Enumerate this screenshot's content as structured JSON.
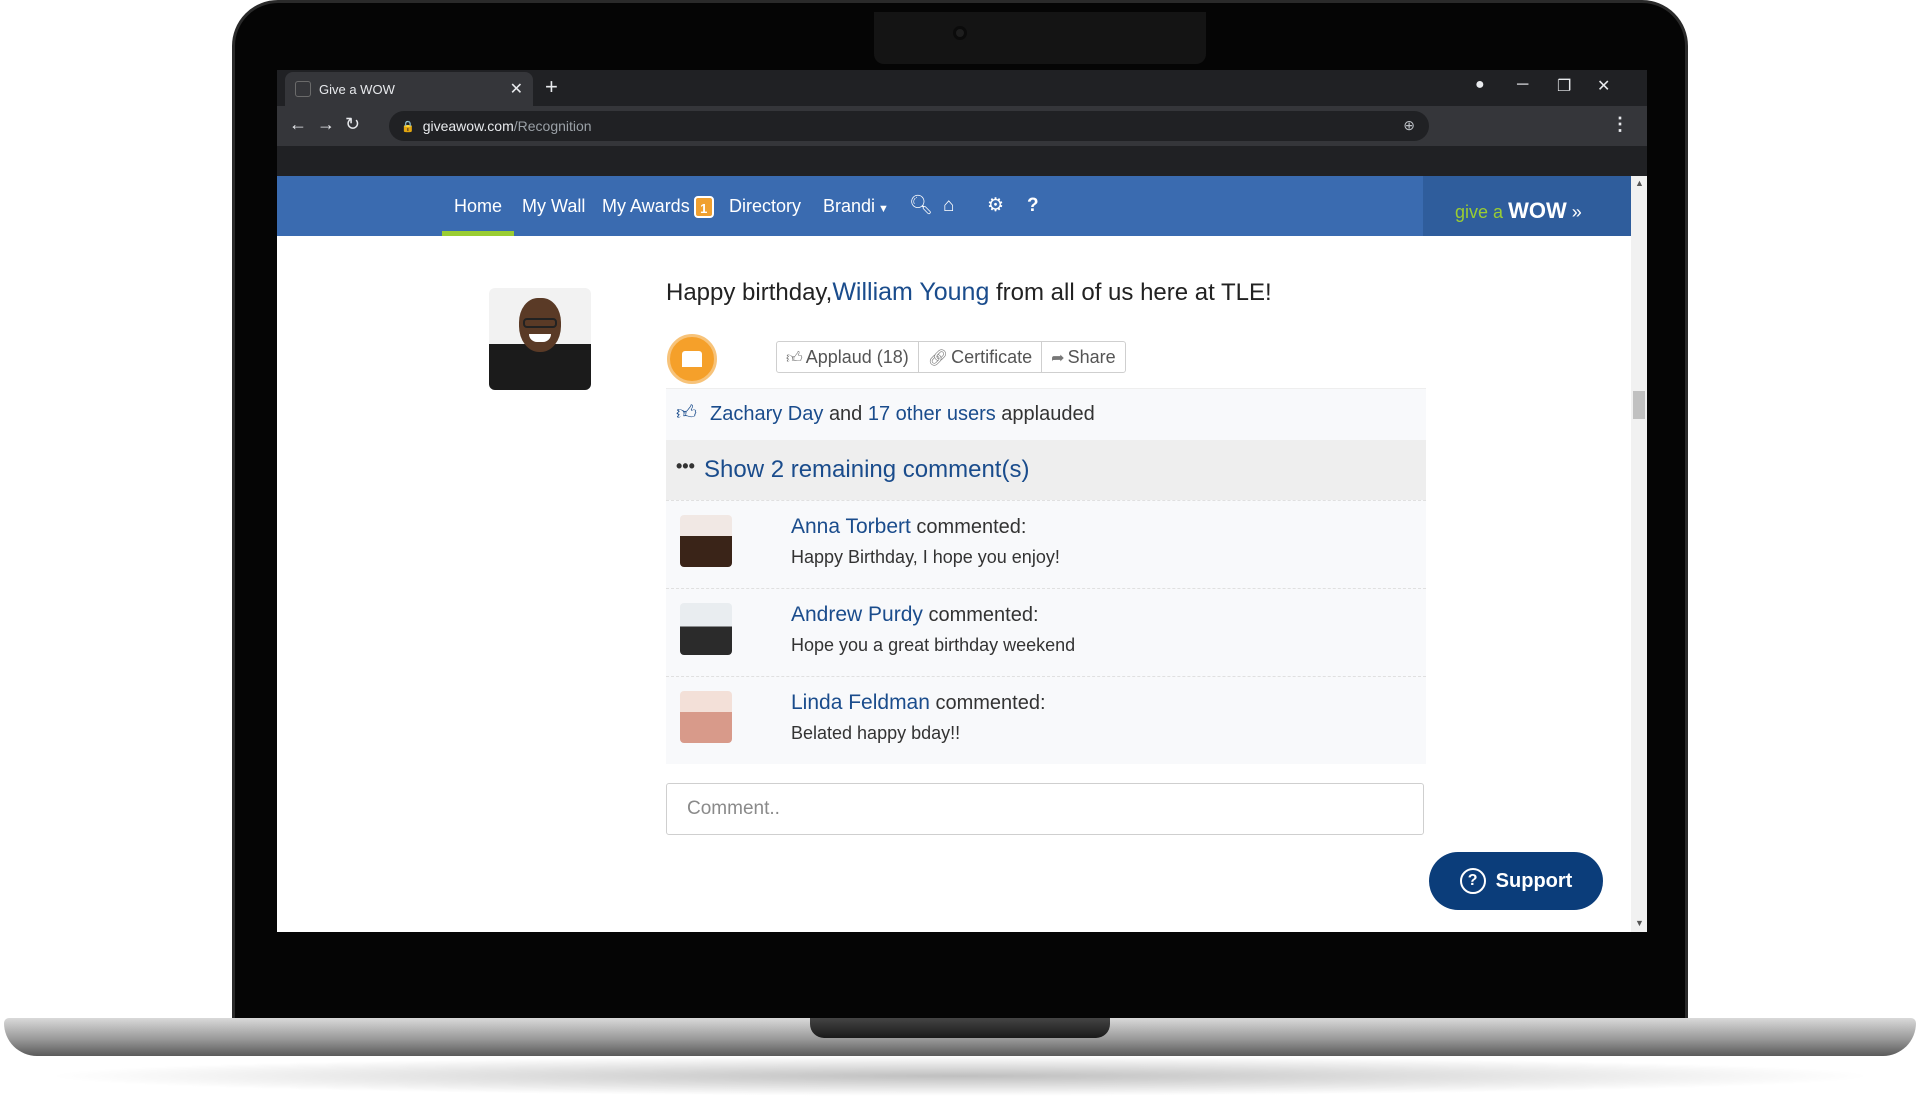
{
  "browser": {
    "tab_title": "Give a WOW",
    "new_tab_label": "+",
    "url_host": "giveawow.com",
    "url_path": "/Recognition"
  },
  "nav": {
    "items": [
      {
        "label": "Home",
        "active": true
      },
      {
        "label": "My Wall"
      },
      {
        "label": "My Awards",
        "badge": "1"
      },
      {
        "label": "Directory"
      },
      {
        "label": "Brandi"
      }
    ],
    "help_label": "?",
    "brand_give": "give a",
    "brand_wow": "WOW",
    "brand_arrows": "»"
  },
  "post": {
    "headline_prefix": "Happy birthday,",
    "recipient": "William Young",
    "headline_suffix": "from all of us here at TLE!",
    "actions": {
      "applaud": "Applaud (18)",
      "certificate": "Certificate",
      "share": "Share"
    },
    "applauded": {
      "first_user": "Zachary Day",
      "and": "and",
      "others": "17 other users",
      "suffix": "applauded"
    },
    "show_remaining": "Show 2 remaining comment(s)",
    "commented_word": "commented:",
    "comments": [
      {
        "author": "Anna Torbert",
        "text": "Happy Birthday, I hope you enjoy!"
      },
      {
        "author": "Andrew Purdy",
        "text": "Hope you a great birthday weekend"
      },
      {
        "author": "Linda Feldman",
        "text": "Belated happy bday!!"
      }
    ],
    "comment_placeholder": "Comment.."
  },
  "support": {
    "label": "Support"
  },
  "colors": {
    "nav_bg": "#3a6bb0",
    "link": "#1a4c8c",
    "accent_green": "#9acd32",
    "support_bg": "#0b3d7a",
    "badge": "#f0a030",
    "cake": "#f5a02a"
  }
}
